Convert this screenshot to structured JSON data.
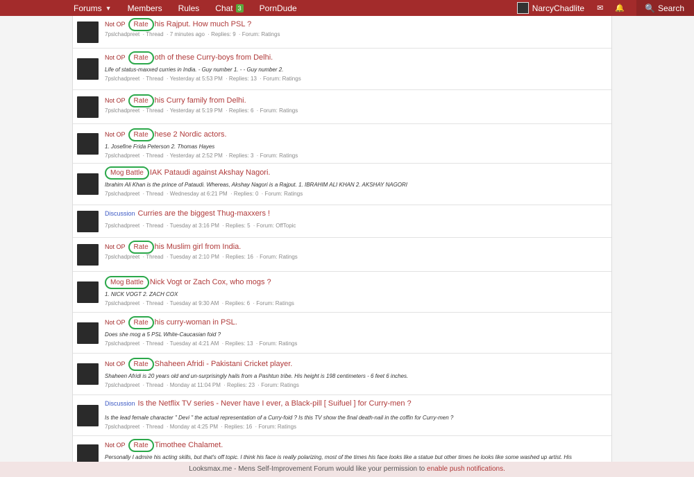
{
  "nav": {
    "items": [
      {
        "label": "Forums"
      },
      {
        "label": "Members"
      },
      {
        "label": "Rules"
      },
      {
        "label": "Chat",
        "badge": "3"
      },
      {
        "label": "PornDude"
      }
    ],
    "username": "NarcyChadlite",
    "search_label": "Search"
  },
  "colors": {
    "header": "#a32b2b",
    "accent": "#2ba84a",
    "title": "#b03a3a",
    "discussion": "#3b58c4"
  },
  "threads": [
    {
      "prefix": "Not OP",
      "tag": "Rate",
      "title": "his Rajput. How much PSL ?",
      "snippet": "",
      "author": "7pslchadpreet",
      "type": "Thread",
      "time": "7 minutes ago",
      "replies": "Replies: 9",
      "forum": "Forum: Ratings"
    },
    {
      "prefix": "Not OP",
      "tag": "Rate",
      "title": "oth of these Curry-boys from Delhi.",
      "snippet": "Life of status-maxxed curries in India. - Guy number 1. - - Guy number 2.",
      "author": "7pslchadpreet",
      "type": "Thread",
      "time": "Yesterday at 5:53 PM",
      "replies": "Replies: 13",
      "forum": "Forum: Ratings"
    },
    {
      "prefix": "Not OP",
      "tag": "Rate",
      "title": "his Curry family from Delhi.",
      "snippet": "",
      "author": "7pslchadpreet",
      "type": "Thread",
      "time": "Yesterday at 5:19 PM",
      "replies": "Replies: 6",
      "forum": "Forum: Ratings"
    },
    {
      "prefix": "Not OP",
      "tag": "Rate",
      "title": "hese 2 Nordic actors.",
      "snippet": "1. Josefine Frida Peterson 2. Thomas Hayes",
      "author": "7pslchadpreet",
      "type": "Thread",
      "time": "Yesterday at 2:52 PM",
      "replies": "Replies: 3",
      "forum": "Forum: Ratings"
    },
    {
      "prefix": "",
      "tag": "Mog Battle",
      "title": "IAK Pataudi against Akshay Nagori.",
      "snippet": "Ibrahim Ali Khan is the prince of Pataudi. Whereas, Akshay Nagori is a Rajput. 1. IBRAHIM ALI KHAN 2. AKSHAY NAGORI",
      "author": "7pslchadpreet",
      "type": "Thread",
      "time": "Wednesday at 6:21 PM",
      "replies": "Replies: 0",
      "forum": "Forum: Ratings"
    },
    {
      "prefix": "Discussion",
      "tag": "",
      "title": "Curries are the biggest Thug-maxxers !",
      "snippet": "",
      "author": "7pslchadpreet",
      "type": "Thread",
      "time": "Tuesday at 3:16 PM",
      "replies": "Replies: 5",
      "forum": "Forum: OffTopic"
    },
    {
      "prefix": "Not OP",
      "tag": "Rate",
      "title": "his Muslim girl from India.",
      "snippet": "",
      "author": "7pslchadpreet",
      "type": "Thread",
      "time": "Tuesday at 2:10 PM",
      "replies": "Replies: 16",
      "forum": "Forum: Ratings"
    },
    {
      "prefix": "",
      "tag": "Mog Battle",
      "title": "Nick Vogt or Zach Cox, who mogs ?",
      "snippet": "1. NICK VOGT 2. ZACH COX",
      "author": "7pslchadpreet",
      "type": "Thread",
      "time": "Tuesday at 9:30 AM",
      "replies": "Replies: 6",
      "forum": "Forum: Ratings"
    },
    {
      "prefix": "Not OP",
      "tag": "Rate",
      "title": "his curry-woman in PSL.",
      "snippet": "Does she mog a 5 PSL White-Caucasian foid ?",
      "author": "7pslchadpreet",
      "type": "Thread",
      "time": "Tuesday at 4:21 AM",
      "replies": "Replies: 13",
      "forum": "Forum: Ratings"
    },
    {
      "prefix": "Not OP",
      "tag": "Rate",
      "title": "Shaheen Afridi - Pakistani Cricket player.",
      "snippet": "Shaheen Afridi is 20 years old and un-surprisingly hails from a Pashtun tribe. His height is 198 centimeters - 6 feet 6 inches.",
      "author": "7pslchadpreet",
      "type": "Thread",
      "time": "Monday at 11:04 PM",
      "replies": "Replies: 23",
      "forum": "Forum: Ratings"
    },
    {
      "prefix": "Discussion",
      "tag": "",
      "title": "Is the Netflix TV series - Never have I ever, a Black-pill [ Suifuel ] for Curry-men ?",
      "snippet": "Is the lead female character \" Devi \" the actual representation of a Curry-foid ? Is this TV show the final death-nail in the coffin for Curry-men ?",
      "author": "7pslchadpreet",
      "type": "Thread",
      "time": "Monday at 4:25 PM",
      "replies": "Replies: 16",
      "forum": "Forum: Ratings"
    },
    {
      "prefix": "Not OP",
      "tag": "Rate",
      "title": "Timothee Chalamet.",
      "snippet": "Personally I admire his acting skills, but that's off topic. I think his face is really polarizing, most of the times his face looks like a statue but other times he looks like some washed up artist. His",
      "author": "",
      "type": "",
      "time": "",
      "replies": "",
      "forum": ""
    }
  ],
  "banner": {
    "text": "Looksmax.me - Mens Self-Improvement Forum would like your permission to ",
    "link": "enable push notifications."
  }
}
